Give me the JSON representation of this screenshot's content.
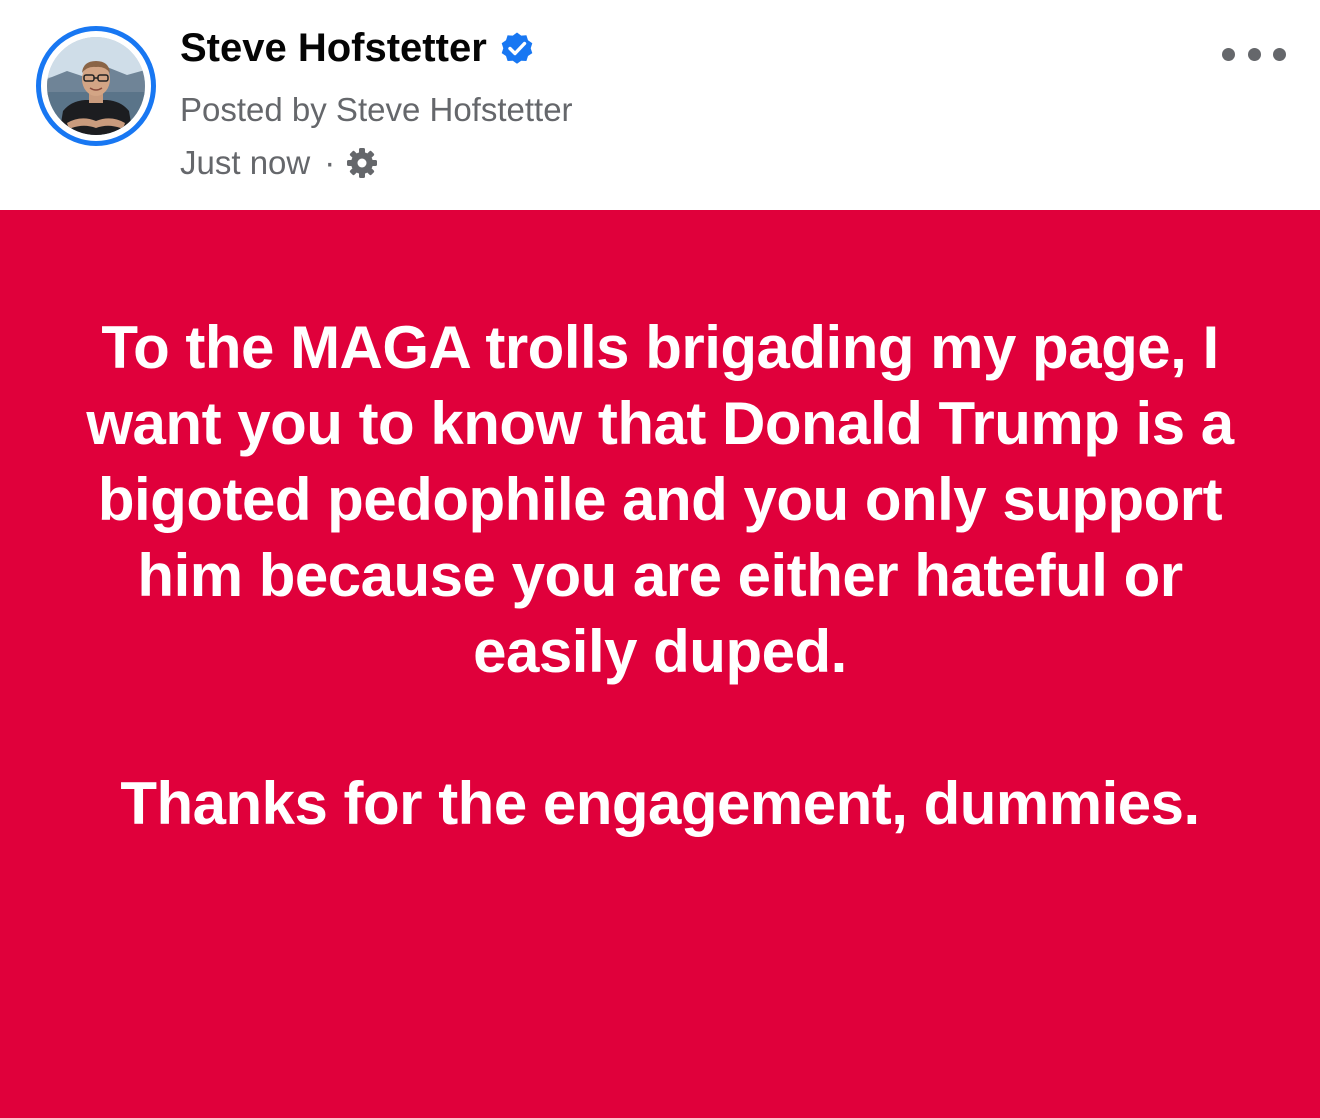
{
  "author": {
    "name": "Steve Hofstetter",
    "posted_by": "Posted by Steve Hofstetter",
    "timestamp": "Just now",
    "separator": "·",
    "verified_icon": "verified-badge-icon",
    "audience_icon": "gear-icon"
  },
  "post": {
    "background_color": "#e0003b",
    "text_color": "#ffffff",
    "paragraphs": [
      "To the MAGA trolls brigading my page, I want you to know that Donald Trump is a bigoted pedophile and you only support him because you are either hateful or easily duped.",
      "Thanks for the engagement, dummies."
    ]
  },
  "menu": {
    "icon": "more-options-icon"
  },
  "colors": {
    "accent": "#1877f2",
    "secondary_text": "#65676b",
    "primary_text": "#050505"
  }
}
